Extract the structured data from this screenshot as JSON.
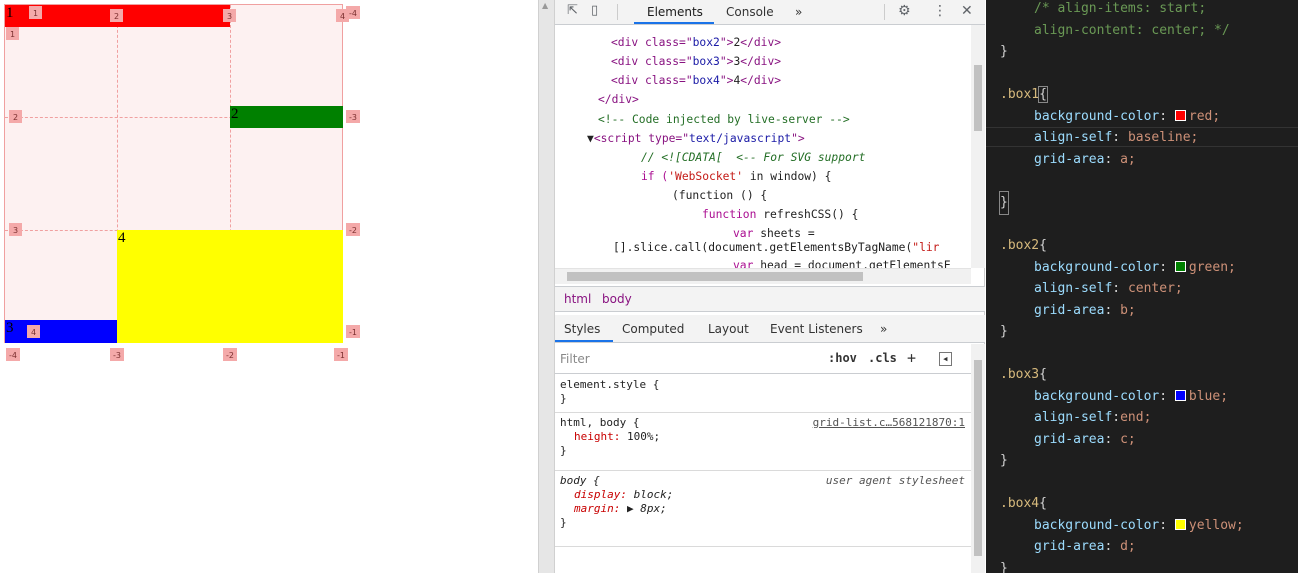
{
  "grid_page": {
    "box_labels": [
      "1",
      "2",
      "3",
      "4"
    ],
    "colors": {
      "box1": "#ff0000",
      "box2": "#008000",
      "box3": "#0000ff",
      "box4": "#ffff00",
      "grid_bg": "#fdf1f1",
      "badge": "#f4a9a9"
    },
    "col_badges_top": [
      "1",
      "2",
      "3",
      "4"
    ],
    "col_badges_top_neg": [
      "-4"
    ],
    "col_badges_bottom": [
      "-4",
      "-3",
      "-2",
      "-1"
    ],
    "row_badges_left": [
      "1",
      "2",
      "3",
      "4"
    ],
    "row_badges_right": [
      "-3",
      "-2",
      "-1"
    ]
  },
  "devtools": {
    "tabs": [
      "Elements",
      "Console"
    ],
    "more_tabs": "»",
    "elements_lines": [
      {
        "pre": "<div class=\"",
        "val": "box2",
        "post": "\">",
        "text": "2",
        "close": "</div>"
      },
      {
        "pre": "<div class=\"",
        "val": "box3",
        "post": "\">",
        "text": "3",
        "close": "</div>"
      },
      {
        "pre": "<div class=\"",
        "val": "box4",
        "post": "\">",
        "text": "4",
        "close": "</div>"
      }
    ],
    "close_div": "</div>",
    "comment": "<!-- Code injected by live-server -->",
    "script_open_pre": "<script type=\"",
    "script_type": "text/javascript",
    "script_open_post": "\">",
    "js_cdata_comment": "// <![CDATA[  <-- For SVG support",
    "js_if_pre": "if (",
    "js_if_str": "'WebSocket'",
    "js_if_post": " in window) {",
    "js_func": "(function () {",
    "js_refresh_kw": "function",
    "js_refresh_name": " refreshCSS() {",
    "js_var_sheets_kw": "var",
    "js_var_sheets": " sheets =",
    "js_slice_pre": "[].slice.call(document.getElementsByTagName(",
    "js_slice_str": "\"lir",
    "js_var_head_kw": "var",
    "js_var_head": " head = document.getElementsE",
    "breadcrumb": [
      "html",
      "body"
    ],
    "style_tabs": [
      "Styles",
      "Computed",
      "Layout",
      "Event Listeners"
    ],
    "styles_more": "»",
    "filter_placeholder": "Filter",
    "filter_hov": ":hov",
    "filter_cls": ".cls",
    "filter_plus": "+",
    "rules": [
      {
        "selector": "element.style {",
        "close": "}"
      },
      {
        "selector": "html, body {",
        "source": "grid-list.c…568121870:1",
        "prop": "height",
        "value": "100%;",
        "close": "}"
      },
      {
        "selector": "body {",
        "source": "user agent stylesheet",
        "prop1": "display",
        "value1": "block;",
        "prop2": "margin",
        "value2": "▶ 8px;",
        "close": "}"
      }
    ]
  },
  "editor": {
    "colors": {
      "red": "#ff0000",
      "green": "#008000",
      "blue": "#0000ff",
      "yellow": "#ffff00"
    },
    "comment_1": "/* align-items: start;",
    "comment_2": "align-content: center; */",
    "box1_selector": ".box1",
    "box1_props": [
      {
        "prop": "background-color",
        "value": "red;",
        "swatch": "red"
      },
      {
        "prop": "align-self",
        "value": "baseline;"
      },
      {
        "prop": "grid-area",
        "value": "a;"
      }
    ],
    "box2_selector": ".box2",
    "box2_props": [
      {
        "prop": "background-color",
        "value": "green;",
        "swatch": "green"
      },
      {
        "prop": "align-self",
        "value": "center;"
      },
      {
        "prop": "grid-area",
        "value": "b;"
      }
    ],
    "box3_selector": ".box3",
    "box3_props": [
      {
        "prop": "background-color",
        "value": "blue;",
        "swatch": "blue"
      },
      {
        "prop": "align-self",
        "value": "end;"
      },
      {
        "prop": "grid-area",
        "value": "c;"
      }
    ],
    "box4_selector": ".box4",
    "box4_props": [
      {
        "prop": "background-color",
        "value": "yellow;",
        "swatch": "yellow"
      },
      {
        "prop": "grid-area",
        "value": "d;"
      }
    ],
    "open_brace": "{",
    "close_brace": "}"
  }
}
